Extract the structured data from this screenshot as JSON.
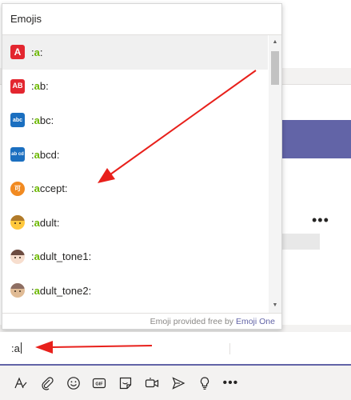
{
  "popup": {
    "title": "Emojis",
    "footer_prefix": "Emoji provided free by",
    "footer_link": "Emoji One"
  },
  "emoji_items": [
    {
      "prefix": ":",
      "match": "a",
      "suffix": ":",
      "icon": "a-button-icon",
      "glyph": "A"
    },
    {
      "prefix": ":",
      "match": "a",
      "suffix": "b:",
      "icon": "ab-button-icon",
      "glyph": "AB"
    },
    {
      "prefix": ":",
      "match": "a",
      "suffix": "bc:",
      "icon": "abc-icon",
      "glyph": "abc"
    },
    {
      "prefix": ":",
      "match": "a",
      "suffix": "bcd:",
      "icon": "abcd-icon",
      "glyph": "ab cd"
    },
    {
      "prefix": ":",
      "match": "a",
      "suffix": "ccept:",
      "icon": "accept-icon",
      "glyph": "可"
    },
    {
      "prefix": ":",
      "match": "a",
      "suffix": "dult:",
      "icon": "adult-face-icon",
      "glyph": ""
    },
    {
      "prefix": ":",
      "match": "a",
      "suffix": "dult_tone1:",
      "icon": "adult-tone1-face-icon",
      "glyph": ""
    },
    {
      "prefix": ":",
      "match": "a",
      "suffix": "dult_tone2:",
      "icon": "adult-tone2-face-icon",
      "glyph": ""
    }
  ],
  "compose": {
    "text": ":a"
  },
  "toolbar_icons": [
    "format-icon",
    "attach-icon",
    "emoji-icon",
    "gif-icon",
    "sticker-icon",
    "meet-now-icon",
    "praise-icon",
    "light-bulb-icon",
    "more-options-icon"
  ],
  "background": {
    "more_dots": "•••"
  },
  "colors": {
    "accent": "#6264a7",
    "match_green": "#6bb700",
    "annotation_red": "#e8201b"
  }
}
